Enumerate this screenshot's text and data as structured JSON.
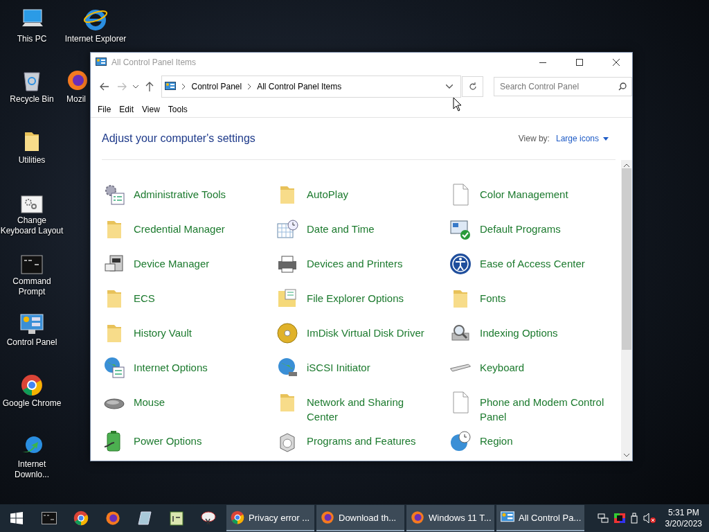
{
  "desktop_icons": [
    {
      "label": "This PC"
    },
    {
      "label": "Internet Explorer"
    },
    {
      "label": "Recycle Bin"
    },
    {
      "label": "Mozil"
    },
    {
      "label": "Utilities"
    },
    {
      "label": "Change Keyboard Layout"
    },
    {
      "label": "Command Prompt"
    },
    {
      "label": "Control Panel"
    },
    {
      "label": "Google Chrome"
    },
    {
      "label": "Internet Downlo..."
    }
  ],
  "window": {
    "title": "All Control Panel Items",
    "breadcrumb": [
      "Control Panel",
      "All Control Panel Items"
    ],
    "search": {
      "placeholder": "Search Control Panel"
    },
    "menu": [
      "File",
      "Edit",
      "View",
      "Tools"
    ],
    "heading": "Adjust your computer's settings",
    "view_by": {
      "label": "View by:",
      "value": "Large icons"
    },
    "items": [
      {
        "label": "Administrative Tools"
      },
      {
        "label": "AutoPlay"
      },
      {
        "label": "Color Management"
      },
      {
        "label": "Credential Manager"
      },
      {
        "label": "Date and Time"
      },
      {
        "label": "Default Programs"
      },
      {
        "label": "Device Manager"
      },
      {
        "label": "Devices and Printers"
      },
      {
        "label": "Ease of Access Center"
      },
      {
        "label": "ECS"
      },
      {
        "label": "File Explorer Options"
      },
      {
        "label": "Fonts"
      },
      {
        "label": "History Vault"
      },
      {
        "label": "ImDisk Virtual Disk Driver"
      },
      {
        "label": "Indexing Options"
      },
      {
        "label": "Internet Options"
      },
      {
        "label": "iSCSI Initiator"
      },
      {
        "label": "Keyboard"
      },
      {
        "label": "Mouse"
      },
      {
        "label": "Network and Sharing Center"
      },
      {
        "label": "Phone and Modem Control Panel"
      },
      {
        "label": "Power Options"
      },
      {
        "label": "Programs and Features"
      },
      {
        "label": "Region"
      }
    ]
  },
  "taskbar": {
    "tasks": [
      {
        "label": "Privacy error ..."
      },
      {
        "label": "Download th..."
      },
      {
        "label": "Windows 11 T..."
      },
      {
        "label": "All Control Pa..."
      }
    ],
    "clock": {
      "time": "5:31 PM",
      "date": "3/20/2023"
    }
  }
}
